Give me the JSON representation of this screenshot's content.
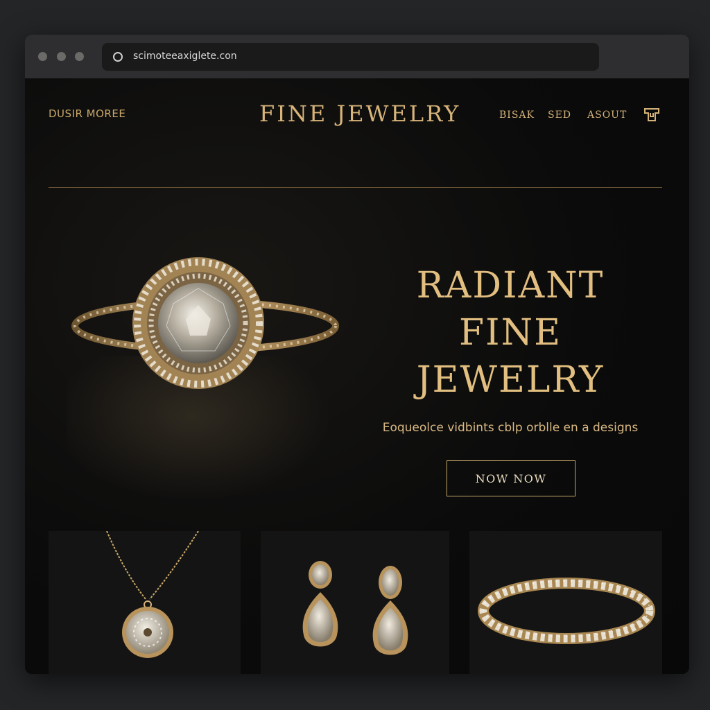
{
  "browser": {
    "url": "scimoteeaxiglete.con"
  },
  "header": {
    "left_text": "DUSIR MOREE",
    "brand": "FINE JEWELRY",
    "nav": [
      "BISAK",
      "SED",
      "ASOUT"
    ]
  },
  "hero": {
    "title_lines": [
      "RADIANT",
      "FINE",
      "JEWELRY"
    ],
    "subtitle": "Eoqueolce vidbints cblp orblle en a designs",
    "cta_label": "NOW NOW"
  },
  "colors": {
    "gold": "#d8b47a",
    "background": "#0b0b0b",
    "page": "#242527"
  },
  "icons": {
    "url": "circle-icon",
    "bag": "shopping-bag-icon"
  },
  "products": [
    {
      "image": "necklace-pendant"
    },
    {
      "image": "drop-earrings"
    },
    {
      "image": "tennis-bracelet"
    }
  ]
}
